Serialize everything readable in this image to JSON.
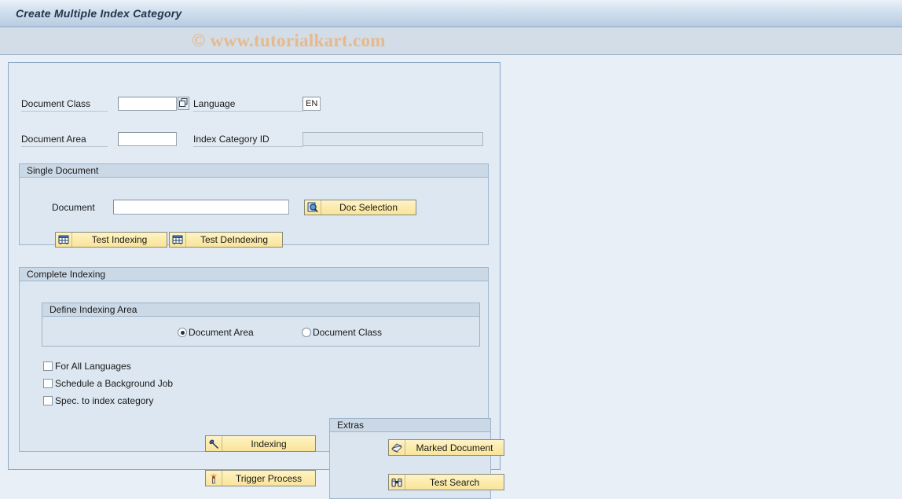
{
  "window": {
    "title": "Create Multiple Index Category",
    "watermark": "© www.tutorialkart.com"
  },
  "form": {
    "document_class": {
      "label": "Document Class",
      "value": "",
      "help_icon": "f4-help-icon"
    },
    "language": {
      "label": "Language",
      "value": "EN"
    },
    "document_area": {
      "label": "Document Area",
      "value": ""
    },
    "index_category_id": {
      "label": "Index Category ID",
      "value": "",
      "enabled": false
    }
  },
  "single_document": {
    "title": "Single Document",
    "document": {
      "label": "Document",
      "value": ""
    },
    "buttons": [
      {
        "label": "Doc Selection",
        "icon": "magnifier-document-icon"
      },
      {
        "label": "Test Indexing",
        "icon": "table-grid-icon"
      },
      {
        "label": "Test DeIndexing",
        "icon": "table-grid-icon"
      }
    ]
  },
  "complete_indexing": {
    "title": "Complete Indexing",
    "define_indexing_area": {
      "title": "Define Indexing Area",
      "options": [
        {
          "label": "Document Area",
          "selected": true
        },
        {
          "label": "Document Class",
          "selected": false
        }
      ]
    },
    "checkboxes": [
      {
        "label": "For All Languages",
        "checked": false
      },
      {
        "label": "Schedule a Background Job",
        "checked": false
      },
      {
        "label": "Spec. to index category",
        "checked": false
      }
    ],
    "buttons": [
      {
        "label": "Indexing",
        "icon": "pen-nib-icon"
      },
      {
        "label": "Trigger Process",
        "icon": "match-flare-icon"
      }
    ],
    "extras": {
      "title": "Extras",
      "buttons": [
        {
          "label": "Marked Document",
          "icon": "stacked-papers-icon"
        },
        {
          "label": "Test Search",
          "icon": "binoculars-icon"
        }
      ]
    }
  },
  "colors": {
    "title_bar": "#b9cde2",
    "panel_bg": "#e2ebf3",
    "button_face": "#fceca e",
    "watermark": "#e7b98c",
    "accent_border": "#8aa7c4"
  }
}
